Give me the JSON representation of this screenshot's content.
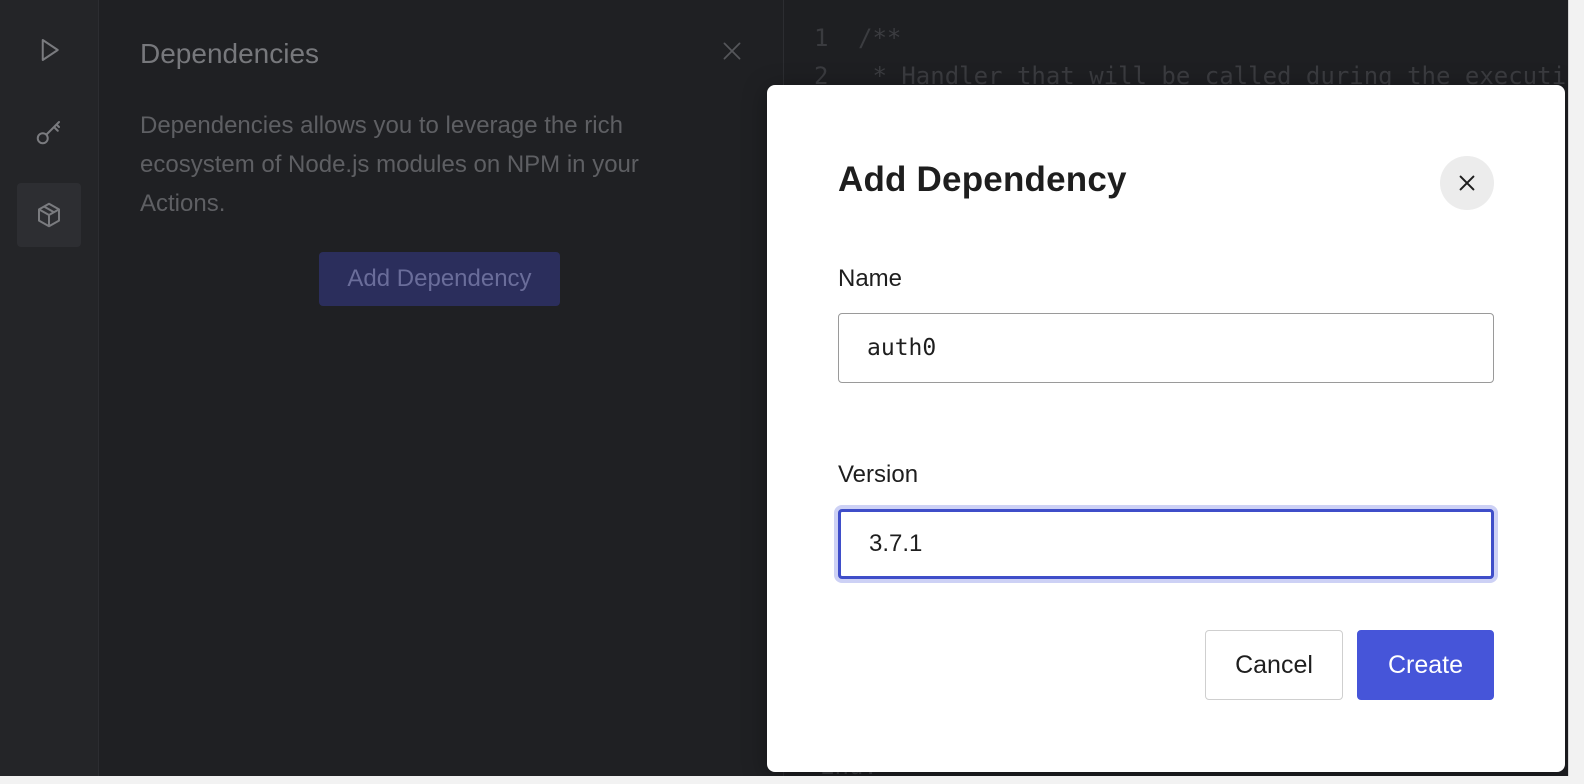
{
  "rail": {
    "items": [
      {
        "icon": "play-icon"
      },
      {
        "icon": "key-icon"
      },
      {
        "icon": "package-icon",
        "active": true
      }
    ]
  },
  "panel": {
    "title": "Dependencies",
    "description": "Dependencies allows you to leverage the rich ecosystem of Node.js modules on NPM in your Actions.",
    "add_button": "Add Dependency"
  },
  "editor": {
    "lines": [
      {
        "number": "1",
        "text": "/**"
      },
      {
        "number": "2",
        "text": " * Handler that will be called during the executi"
      }
    ],
    "bottom_fragment": "Enu."
  },
  "modal": {
    "title": "Add Dependency",
    "name_label": "Name",
    "name_value": "auth0",
    "version_label": "Version",
    "version_value": "3.7.1",
    "cancel_label": "Cancel",
    "create_label": "Create"
  },
  "colors": {
    "accent": "#4655d9",
    "focus_ring": "#cdd1f5",
    "background": "#1f2023"
  }
}
